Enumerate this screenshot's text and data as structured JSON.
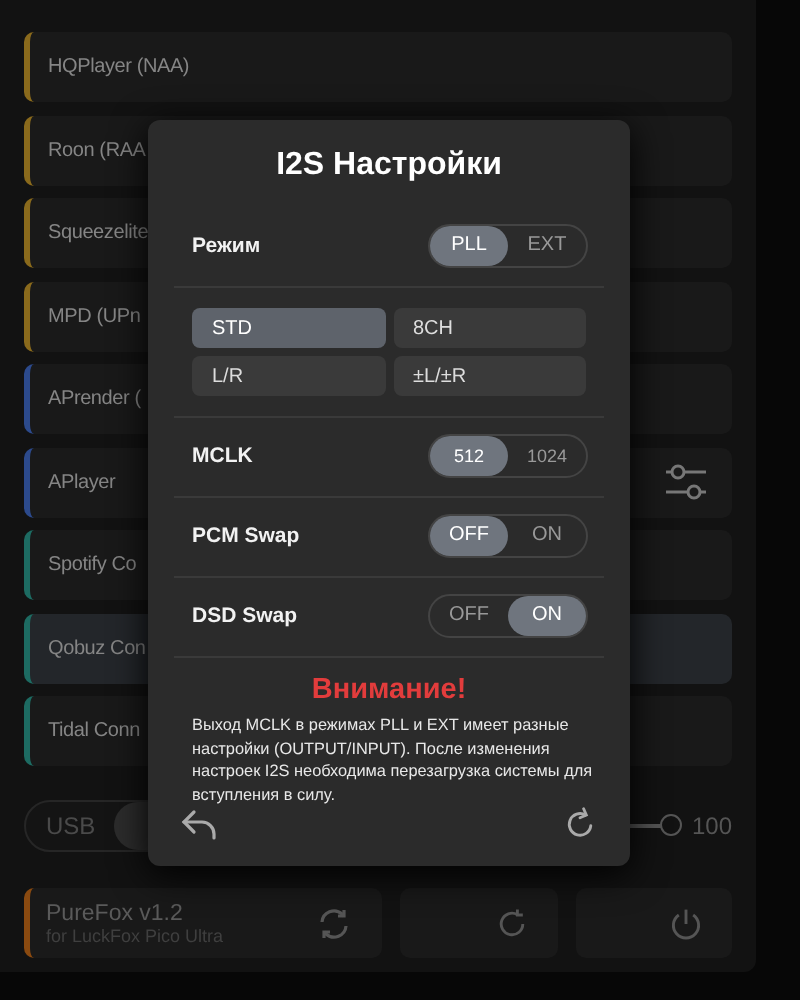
{
  "services": [
    {
      "name": "HQPlayer (NAA)",
      "color": "#8a6a1c",
      "selected": false,
      "settings": false
    },
    {
      "name": "Roon (RAA",
      "color": "#8a6a1c",
      "selected": false,
      "settings": false
    },
    {
      "name": "Squeezelite",
      "color": "#8a6a1c",
      "selected": false,
      "settings": false
    },
    {
      "name": "MPD (UPn",
      "color": "#8a6a1c",
      "selected": false,
      "settings": false
    },
    {
      "name": "APrender (",
      "color": "#2c4a8c",
      "selected": false,
      "settings": false
    },
    {
      "name": "APlayer",
      "color": "#2c4a8c",
      "selected": false,
      "settings": true
    },
    {
      "name": "Spotify Co",
      "color": "#1d6b62",
      "selected": false,
      "settings": false
    },
    {
      "name": "Qobuz Con",
      "color": "#1d6b62",
      "selected": true,
      "settings": false
    },
    {
      "name": "Tidal Conn",
      "color": "#1d6b62",
      "selected": false,
      "settings": false
    }
  ],
  "output": {
    "label": "USB",
    "selected": false,
    "volume": {
      "level": 1,
      "reading": "100"
    }
  },
  "footer": {
    "title": "PureFox v1.2",
    "subtitle": "for LuckFox Pico Ultra",
    "color": "#8a4a10"
  },
  "dialog": {
    "title": "I2S Настройки",
    "mode": {
      "label": "Режим",
      "options": [
        {
          "label": "PLL",
          "selected": true
        },
        {
          "label": "EXT",
          "selected": false
        }
      ]
    },
    "formats": [
      {
        "label": "STD",
        "selected": true
      },
      {
        "label": "8CH",
        "selected": false
      },
      {
        "label": "L/R",
        "selected": false
      },
      {
        "label": "±L/±R",
        "selected": false
      }
    ],
    "settings": [
      {
        "label": "MCLK",
        "small": true,
        "options": [
          {
            "label": "512",
            "selected": true
          },
          {
            "label": "1024",
            "selected": false
          }
        ]
      },
      {
        "label": "PCM Swap",
        "small": false,
        "options": [
          {
            "label": "OFF",
            "selected": true
          },
          {
            "label": "ON",
            "selected": false
          }
        ]
      },
      {
        "label": "DSD Swap",
        "small": false,
        "options": [
          {
            "label": "OFF",
            "selected": false
          },
          {
            "label": "ON",
            "selected": true
          }
        ]
      }
    ],
    "warning_title": "Внимание!",
    "warning_text": "Выход MCLK в режимах PLL и EXT имеет разные настройки (OUTPUT/INPUT). После изменения настроек I2S необходима перезагрузка системы для вступления в силу."
  }
}
